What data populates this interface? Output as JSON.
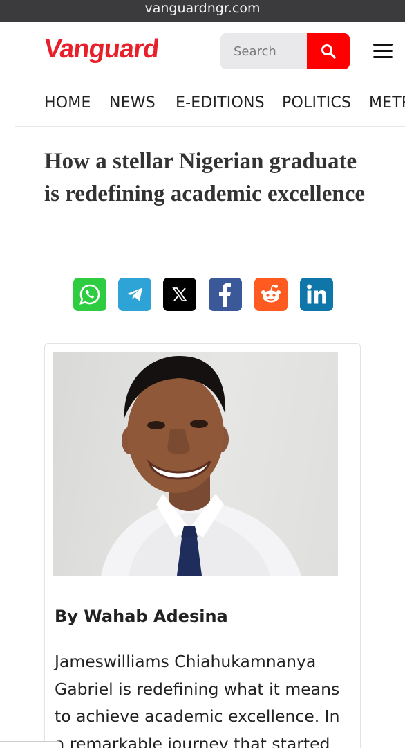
{
  "browser": {
    "url": "vanguardngr.com"
  },
  "header": {
    "logo_text": "Vanguard",
    "search_placeholder": "Search",
    "brand_color": "#e8202a",
    "search_button_color": "#ff0000"
  },
  "nav": {
    "items": [
      {
        "label": "HOME"
      },
      {
        "label": "NEWS"
      },
      {
        "label": "E-EDITIONS"
      },
      {
        "label": "POLITICS"
      },
      {
        "label": "METRO"
      }
    ]
  },
  "article": {
    "title": "How a stellar Nigerian graduate is redefining academic excellence",
    "share": [
      {
        "name": "whatsapp",
        "icon": "whatsapp-icon",
        "color": "#2ecc40"
      },
      {
        "name": "telegram",
        "icon": "telegram-icon",
        "color": "#2ea3d6"
      },
      {
        "name": "x",
        "icon": "x-icon",
        "color": "#000000"
      },
      {
        "name": "facebook",
        "icon": "facebook-icon",
        "color": "#3b5998"
      },
      {
        "name": "reddit",
        "icon": "reddit-icon",
        "color": "#ff5a1f"
      },
      {
        "name": "linkedin",
        "icon": "linkedin-icon",
        "color": "#0e76a8"
      }
    ],
    "byline": "By Wahab Adesina",
    "body": "Jameswilliams Chiahukamnanya Gabriel is redefining what it means to achieve academic excellence. In a remarkable journey that started"
  }
}
